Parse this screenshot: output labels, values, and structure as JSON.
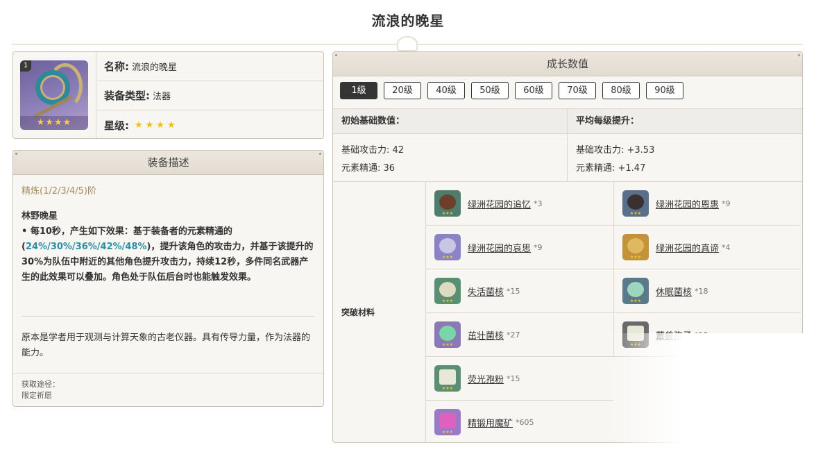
{
  "page": {
    "title": "流浪的晚星"
  },
  "weapon": {
    "refinement_badge": "1",
    "icon_stars": "★★★★",
    "name_label": "名称:",
    "name_value": "流浪的晚星",
    "type_label": "装备类型:",
    "type_value": "法器",
    "rarity_label": "星级:",
    "rarity_stars": "★★★★"
  },
  "description": {
    "header": "装备描述",
    "refine_label": "精炼(1/2/3/4/5)阶",
    "passive_name": "林野晚星",
    "passive_text_1": "• 每10秒，产生如下效果：基于装备者的元素精通的(",
    "passive_highlight": "24%/30%/36%/42%/48%",
    "passive_text_2": ")，提升该角色的攻击力，并基于该提升的30%为队伍中附近的其他角色提升攻击力，持续12秒，多件同名武器产生的此效果可以叠加。角色处于队伍后台时也能触发效果。",
    "lore": "原本是学者用于观测与计算天象的古老仪器。具有传导力量，作为法器的能力。",
    "source_label": "获取途径：",
    "source_value": "限定祈愿"
  },
  "growth": {
    "header": "成长数值",
    "levels": [
      "1级",
      "20级",
      "40级",
      "50级",
      "60级",
      "70级",
      "80级",
      "90级"
    ],
    "active_level": "1级",
    "initial_header": "初始基础数值：",
    "avg_header": "平均每级提升：",
    "initial_atk": "基础攻击力: 42",
    "initial_em": "元素精通: 36",
    "avg_atk": "基础攻击力: +3.53",
    "avg_em": "元素精通: +1.47",
    "materials_label": "突破材料",
    "materials": [
      {
        "name": "绿洲花园的追忆",
        "count": "*3",
        "icon": "chalice-icon",
        "color": "#4e7d6e",
        "inner": "#6b3f2a"
      },
      {
        "name": "绿洲花园的恩惠",
        "count": "*9",
        "icon": "chalice-icon",
        "color": "#5a6f8a",
        "inner": "#3a3030"
      },
      {
        "name": "绿洲花园的哀思",
        "count": "*9",
        "icon": "chalice-icon",
        "color": "#8a84c4",
        "inner": "#c9c6e4"
      },
      {
        "name": "绿洲花园的真谛",
        "count": "*4",
        "icon": "chalice-icon",
        "color": "#c4923a",
        "inner": "#e0b860"
      },
      {
        "name": "失活菌核",
        "count": "*15",
        "icon": "fungal-nucleus-icon",
        "color": "#5a8f74",
        "inner": "#dcdcc0"
      },
      {
        "name": "休眠菌核",
        "count": "*18",
        "icon": "fungal-nucleus-icon",
        "color": "#5a7a8a",
        "inner": "#9ad6c0"
      },
      {
        "name": "茁壮菌核",
        "count": "*27",
        "icon": "fungal-nucleus-icon",
        "color": "#8a7ab4",
        "inner": "#7ad6a8"
      },
      {
        "name": "蕈兽孢子",
        "count": "*10",
        "icon": "spore-icon",
        "color": "#6a6a6a",
        "inner": "#e8e8d8"
      },
      {
        "name": "荧光孢粉",
        "count": "*15",
        "icon": "spore-icon",
        "color": "#5a8f74",
        "inner": "#e8e8d8"
      },
      {
        "name": "精锻用魔矿",
        "count": "*605",
        "icon": "crystal-ore-icon",
        "color": "#9a7ac4",
        "inner": "#e060c0"
      }
    ]
  },
  "colors": {
    "highlight": "#2b8fa8",
    "refine_label": "#a58a5f",
    "star": "#f3b91f"
  }
}
